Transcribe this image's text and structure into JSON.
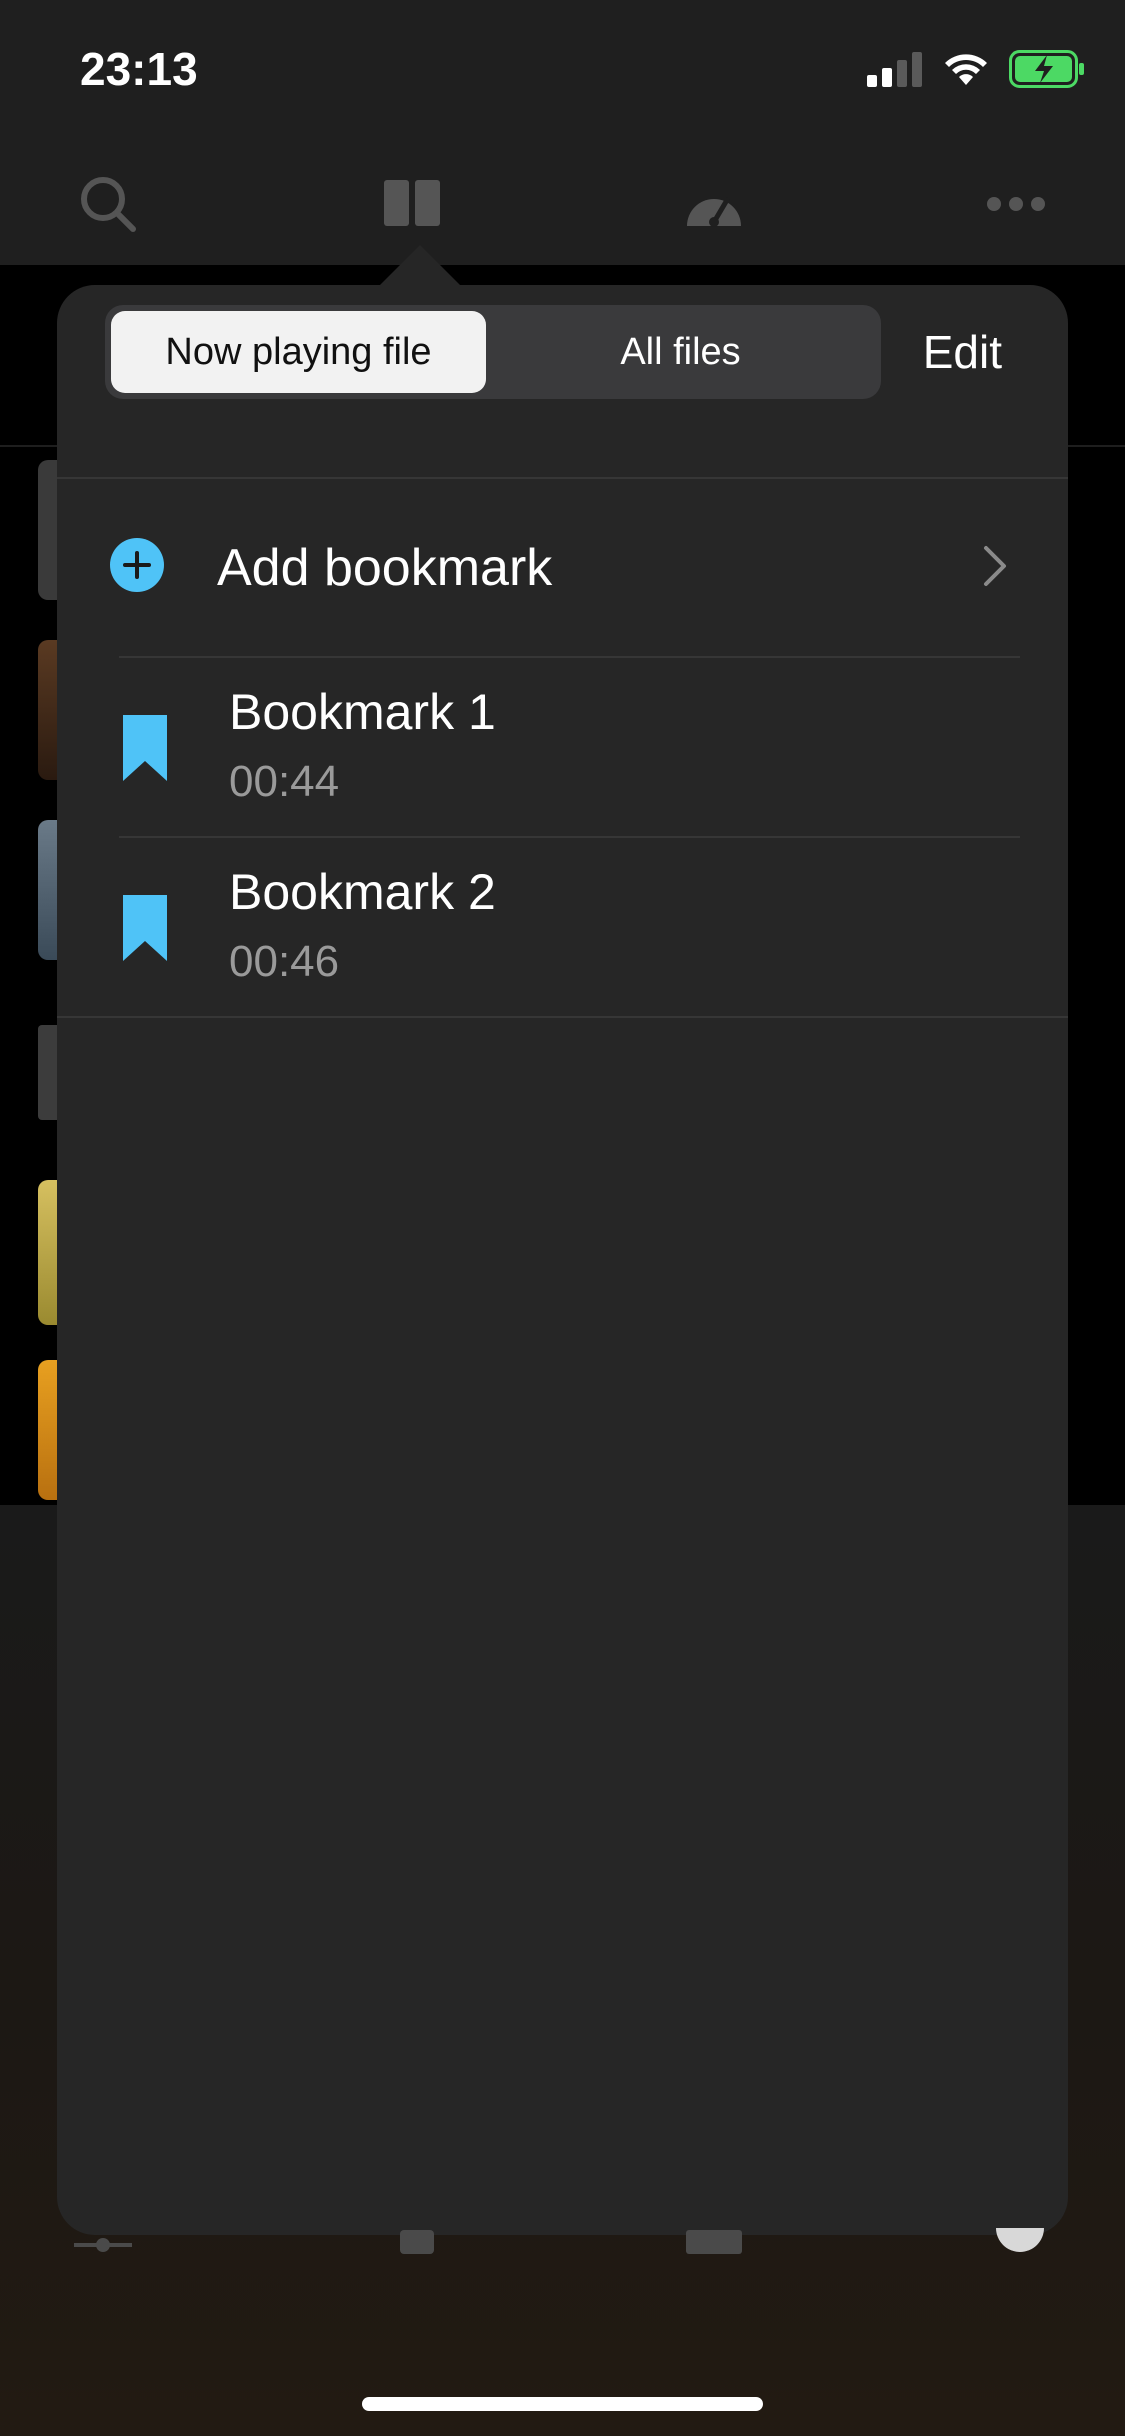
{
  "status_bar": {
    "time": "23:13"
  },
  "toolbar": {
    "icons": [
      "search-icon",
      "book-icon",
      "speedometer-icon",
      "more-icon"
    ]
  },
  "popover": {
    "segments": {
      "now_playing": "Now playing file",
      "all_files": "All files",
      "selected": "Now playing file"
    },
    "edit_label": "Edit",
    "add_bookmark_label": "Add bookmark",
    "bookmarks": [
      {
        "title": "Bookmark 1",
        "time": "00:44"
      },
      {
        "title": "Bookmark 2",
        "time": "00:46"
      }
    ]
  },
  "colors": {
    "accent": "#4fc3f7",
    "popover_bg": "#262626",
    "segment_active_bg": "#f2f2f2"
  }
}
